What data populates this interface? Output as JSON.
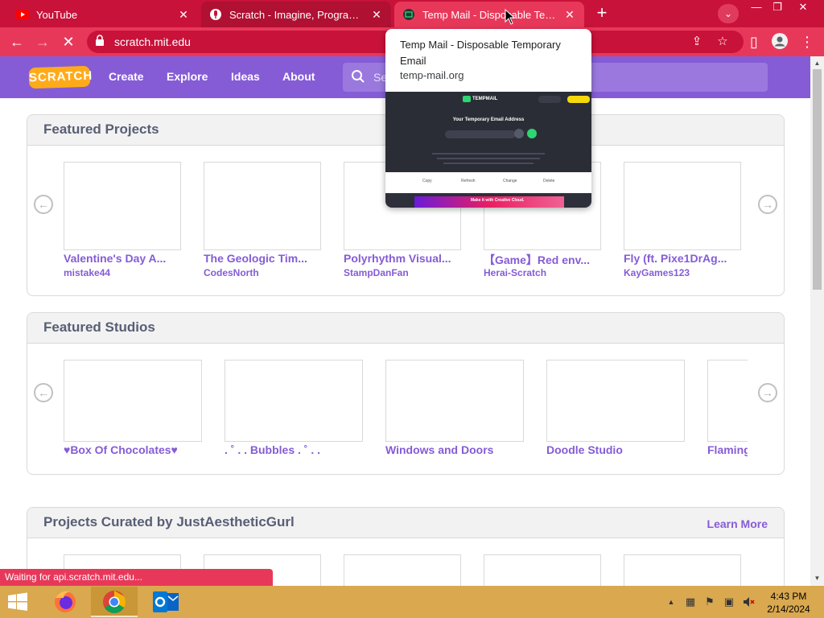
{
  "browser": {
    "tabs": [
      {
        "title": "YouTube",
        "favicon": "youtube-icon"
      },
      {
        "title": "Scratch - Imagine, Program, Share",
        "favicon": "scratch-recording-icon"
      },
      {
        "title": "Temp Mail - Disposable Temporary Email",
        "favicon": "tempmail-icon"
      }
    ],
    "new_tab_label": "+",
    "url": "scratch.mit.edu",
    "status_text": "Waiting for api.scratch.mit.edu...",
    "accent_color": "#e8385a"
  },
  "hover_card": {
    "title": "Temp Mail - Disposable Temporary Email",
    "domain": "temp-mail.org",
    "preview": {
      "brand": "TEMPMAIL",
      "heading": "Your Temporary Email Address",
      "actions": [
        "Copy",
        "Refresh",
        "Change",
        "Delete"
      ],
      "ad_text": "Make it with Creative Cloud."
    }
  },
  "scratch": {
    "logo": "SCRATCH",
    "nav": [
      "Create",
      "Explore",
      "Ideas",
      "About"
    ],
    "search_placeholder": "Search",
    "brand_color": "#855cd6"
  },
  "featured_projects": {
    "heading": "Featured Projects",
    "items": [
      {
        "title": "Valentine's Day A...",
        "author": "mistake44"
      },
      {
        "title": "The Geologic Tim...",
        "author": "CodesNorth"
      },
      {
        "title": "Polyrhythm Visual...",
        "author": "StampDanFan"
      },
      {
        "title": "【Game】Red env...",
        "author": "Herai-Scratch"
      },
      {
        "title": "Fly (ft. Pixe1DrAg...",
        "author": "KayGames123"
      }
    ]
  },
  "featured_studios": {
    "heading": "Featured Studios",
    "items": [
      {
        "title": "♥Box Of Chocolates♥"
      },
      {
        "title": ". ˚ . . Bubbles . ˚ . ."
      },
      {
        "title": "Windows and Doors"
      },
      {
        "title": "Doodle Studio"
      },
      {
        "title": "Flaming"
      }
    ]
  },
  "curated": {
    "heading": "Projects Curated by JustAestheticGurl",
    "learn_more": "Learn More"
  },
  "taskbar": {
    "apps": [
      "firefox-icon",
      "chrome-icon",
      "outlook-icon"
    ],
    "time": "4:43 PM",
    "date": "2/14/2024"
  }
}
